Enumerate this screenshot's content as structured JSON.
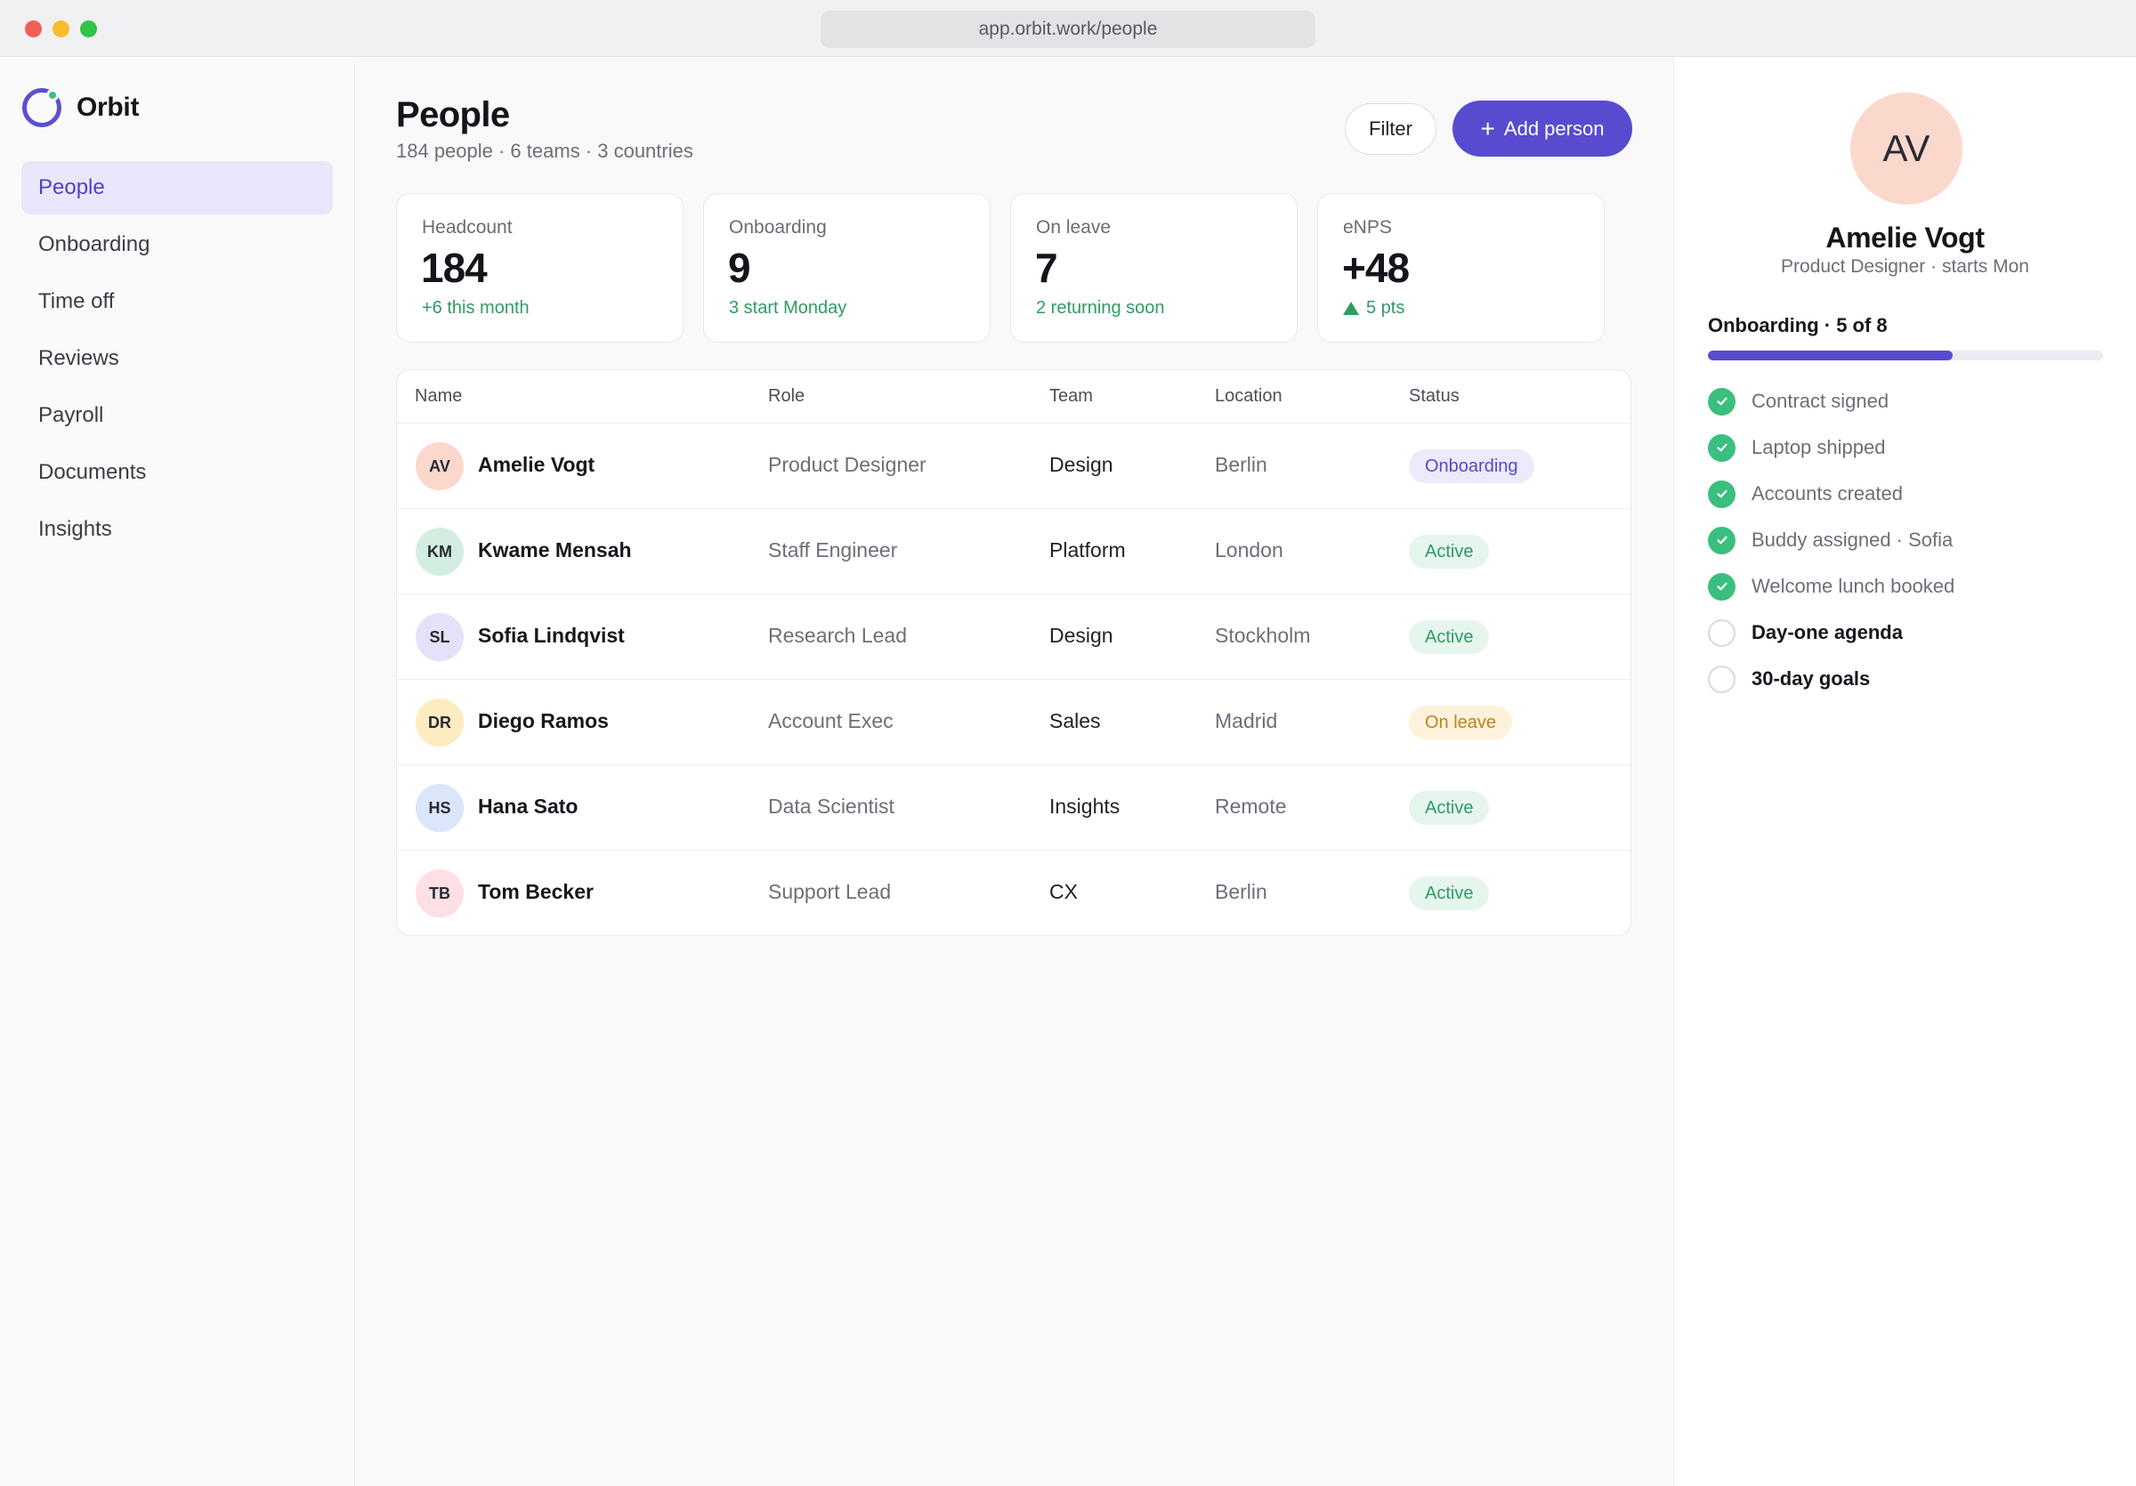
{
  "browser": {
    "url": "app.orbit.work/people"
  },
  "app": {
    "name": "Orbit"
  },
  "sidebar": {
    "items": [
      {
        "label": "People",
        "active": true
      },
      {
        "label": "Onboarding",
        "active": false
      },
      {
        "label": "Time off",
        "active": false
      },
      {
        "label": "Reviews",
        "active": false
      },
      {
        "label": "Payroll",
        "active": false
      },
      {
        "label": "Documents",
        "active": false
      },
      {
        "label": "Insights",
        "active": false
      }
    ]
  },
  "header": {
    "title": "People",
    "subtitle": "184 people · 6 teams · 3 countries",
    "filter_label": "Filter",
    "add_icon": "+",
    "add_label": "Add person"
  },
  "stats": [
    {
      "label": "Headcount",
      "value": "184",
      "note": "+6 this month"
    },
    {
      "label": "Onboarding",
      "value": "9",
      "note": "3 start Monday"
    },
    {
      "label": "On leave",
      "value": "7",
      "note": "2 returning soon"
    },
    {
      "label": "eNPS",
      "value": "+48",
      "note": "5 pts",
      "trend_icon": "triangle-up-icon"
    }
  ],
  "table": {
    "columns": [
      "Name",
      "Role",
      "Team",
      "Location",
      "Status"
    ],
    "rows": [
      {
        "initials": "AV",
        "name": "Amelie Vogt",
        "role": "Product Designer",
        "team": "Design",
        "location": "Berlin",
        "status": "Onboarding",
        "avatar_color": "#fbd8cc",
        "status_bg": "#eceafc",
        "status_color": "#554ac8"
      },
      {
        "initials": "KM",
        "name": "Kwame Mensah",
        "role": "Staff Engineer",
        "team": "Platform",
        "location": "London",
        "status": "Active",
        "avatar_color": "#d3eee0",
        "status_bg": "#e6f6ed",
        "status_color": "#2e9b63"
      },
      {
        "initials": "SL",
        "name": "Sofia Lindqvist",
        "role": "Research Lead",
        "team": "Design",
        "location": "Stockholm",
        "status": "Active",
        "avatar_color": "#e5e1f8",
        "status_bg": "#e6f6ed",
        "status_color": "#2e9b63"
      },
      {
        "initials": "DR",
        "name": "Diego Ramos",
        "role": "Account Exec",
        "team": "Sales",
        "location": "Madrid",
        "status": "On leave",
        "avatar_color": "#fcecc0",
        "status_bg": "#fdf2dc",
        "status_color": "#c08214"
      },
      {
        "initials": "HS",
        "name": "Hana Sato",
        "role": "Data Scientist",
        "team": "Insights",
        "location": "Remote",
        "status": "Active",
        "avatar_color": "#dbe6fb",
        "status_bg": "#e6f6ed",
        "status_color": "#2e9b63"
      },
      {
        "initials": "TB",
        "name": "Tom Becker",
        "role": "Support Lead",
        "team": "CX",
        "location": "Berlin",
        "status": "Active",
        "avatar_color": "#fde0e5",
        "status_bg": "#e6f6ed",
        "status_color": "#2e9b63"
      }
    ]
  },
  "panel": {
    "initials": "AV",
    "name": "Amelie Vogt",
    "subtitle": "Product Designer · starts Mon",
    "section_title": "Onboarding · 5 of 8",
    "progress": 0.62,
    "checklist": [
      {
        "label": "Contract signed",
        "done": true
      },
      {
        "label": "Laptop shipped",
        "done": true
      },
      {
        "label": "Accounts created",
        "done": true
      },
      {
        "label": "Buddy assigned · Sofia",
        "done": true
      },
      {
        "label": "Welcome lunch booked",
        "done": true
      },
      {
        "label": "Day-one agenda",
        "done": false
      },
      {
        "label": "30-day goals",
        "done": false
      }
    ]
  },
  "colors": {
    "accent": "#574ccf",
    "success": "#2e9b63",
    "check_done": "#3bbf7e"
  }
}
